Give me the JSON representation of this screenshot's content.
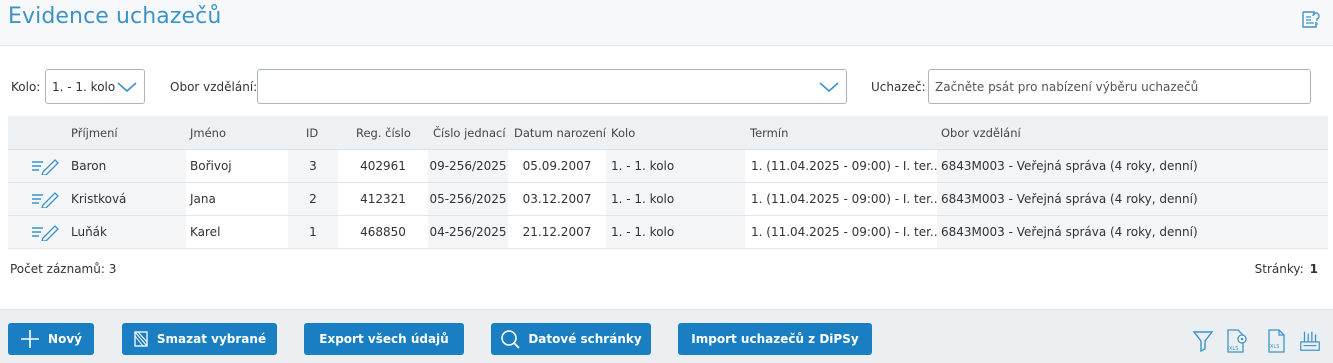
{
  "header": {
    "title": "Evidence uchazečů"
  },
  "filters": {
    "kolo_label": "Kolo:",
    "kolo_value": "1. - 1. kolo",
    "obor_label": "Obor vzdělání:",
    "obor_value": "",
    "uchazec_label": "Uchazeč:",
    "uchazec_placeholder": "Začněte psát pro nabízení výběru uchazečů"
  },
  "table": {
    "columns": [
      "Příjmení",
      "Jméno",
      "ID",
      "Reg. číslo",
      "Číslo jednací",
      "Datum narození",
      "Kolo",
      "Termín",
      "Obor vzdělání"
    ],
    "rows": [
      {
        "prijmeni": "Baron",
        "jmeno": "Bořivoj",
        "id": "3",
        "reg": "402961",
        "cj": "09-256/2025",
        "datum": "05.09.2007",
        "kolo": "1. - 1. kolo",
        "termin": "1. (11.04.2025 - 09:00) - I. ter...",
        "obor": "6843M003 - Veřejná správa (4 roky, denní)"
      },
      {
        "prijmeni": "Kristková",
        "jmeno": "Jana",
        "id": "2",
        "reg": "412321",
        "cj": "05-256/2025",
        "datum": "03.12.2007",
        "kolo": "1. - 1. kolo",
        "termin": "1. (11.04.2025 - 09:00) - I. ter...",
        "obor": "6843M003 - Veřejná správa (4 roky, denní)"
      },
      {
        "prijmeni": "Luňák",
        "jmeno": "Karel",
        "id": "1",
        "reg": "468850",
        "cj": "04-256/2025",
        "datum": "21.12.2007",
        "kolo": "1. - 1. kolo",
        "termin": "1. (11.04.2025 - 09:00) - I. ter...",
        "obor": "6843M003 - Veřejná správa (4 roky, denní)"
      }
    ]
  },
  "footer": {
    "count_label": "Počet záznamů: 3",
    "pages_label": "Stránky:",
    "pages_value": "1"
  },
  "toolbar": {
    "new": "Nový",
    "delete": "Smazat vybrané",
    "export": "Export všech údajů",
    "datove": "Datové schránky",
    "import": "Import uchazečů z DiPSy"
  },
  "colors": {
    "accent": "#1a7fc2",
    "title": "#3d93c9"
  },
  "icons": [
    "help-icon",
    "chevron-down-icon",
    "edit-icon",
    "plus-icon",
    "delete-icon",
    "search-icon",
    "filter-icon",
    "xls-settings-icon",
    "xls-icon",
    "import-icon"
  ]
}
